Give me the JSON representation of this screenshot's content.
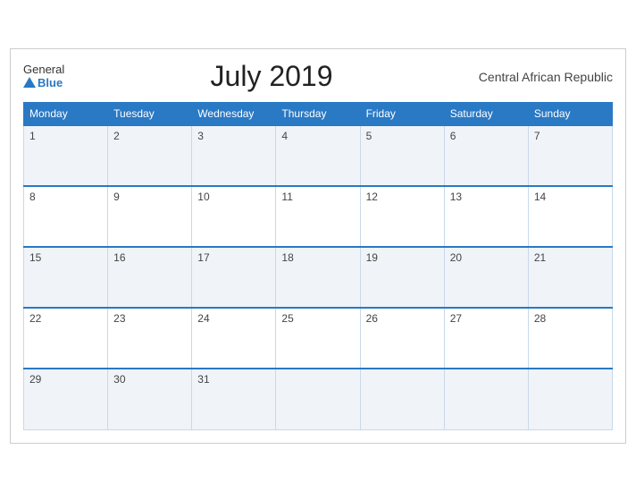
{
  "header": {
    "logo_general": "General",
    "logo_blue": "Blue",
    "title": "July 2019",
    "region": "Central African Republic"
  },
  "weekdays": [
    "Monday",
    "Tuesday",
    "Wednesday",
    "Thursday",
    "Friday",
    "Saturday",
    "Sunday"
  ],
  "weeks": [
    [
      1,
      2,
      3,
      4,
      5,
      6,
      7
    ],
    [
      8,
      9,
      10,
      11,
      12,
      13,
      14
    ],
    [
      15,
      16,
      17,
      18,
      19,
      20,
      21
    ],
    [
      22,
      23,
      24,
      25,
      26,
      27,
      28
    ],
    [
      29,
      30,
      31,
      null,
      null,
      null,
      null
    ]
  ]
}
